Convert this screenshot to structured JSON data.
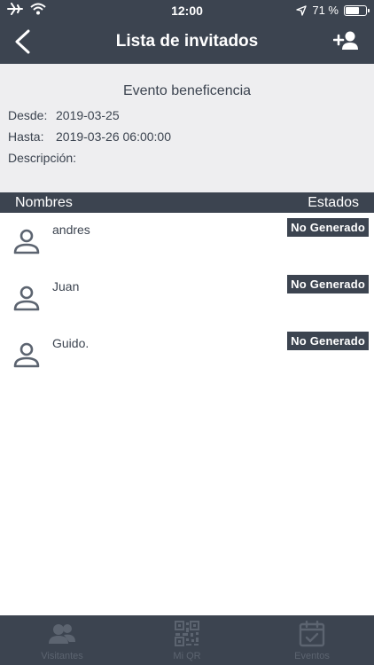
{
  "status_bar": {
    "time": "12:00",
    "battery_label": "71 %",
    "battery_level": 0.71
  },
  "nav": {
    "title": "Lista de invitados"
  },
  "event": {
    "name": "Evento beneficencia",
    "desde_label": "Desde:",
    "desde_value": "2019-03-25",
    "hasta_label": "Hasta:",
    "hasta_value": "2019-03-26 06:00:00",
    "descripcion_label": "Descripción:",
    "descripcion_value": ""
  },
  "list": {
    "col_names": "Nombres",
    "col_status": "Estados",
    "guests": [
      {
        "name": "andres",
        "status": "No Generado"
      },
      {
        "name": "Juan",
        "status": "No Generado"
      },
      {
        "name": "Guido.",
        "status": "No Generado"
      }
    ]
  },
  "tabs": [
    {
      "label": "Visitantes",
      "icon": "visitors-icon"
    },
    {
      "label": "Mi QR",
      "icon": "qr-code-icon"
    },
    {
      "label": "Eventos",
      "icon": "calendar-check-icon"
    }
  ],
  "colors": {
    "primary": "#3c4450",
    "panel": "#eeeef0",
    "muted": "#5c6470"
  }
}
